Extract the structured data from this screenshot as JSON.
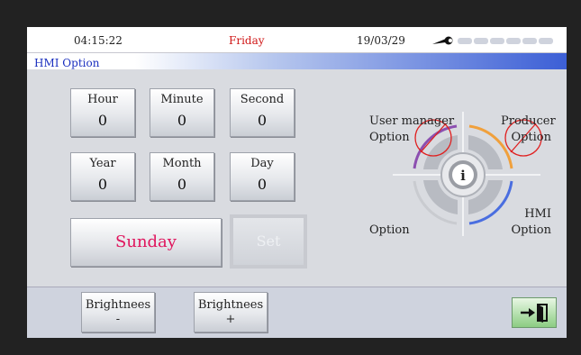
{
  "status": {
    "time": "04:15:22",
    "weekday": "Friday",
    "date": "19/03/29"
  },
  "title": {
    "tab": "HMI Option"
  },
  "time_fields": [
    {
      "label": "Hour",
      "value": "0"
    },
    {
      "label": "Minute",
      "value": "0"
    },
    {
      "label": "Second",
      "value": "0"
    }
  ],
  "date_fields": [
    {
      "label": "Year",
      "value": "0"
    },
    {
      "label": "Month",
      "value": "0"
    },
    {
      "label": "Day",
      "value": "0"
    }
  ],
  "weekday_button": "Sunday",
  "set_button": "Set",
  "options": {
    "user_manager": [
      "User manager",
      "Option"
    ],
    "producer": [
      "Producer",
      "Option"
    ],
    "bottom_left": [
      "Option"
    ],
    "hmi": [
      "HMI",
      "Option"
    ]
  },
  "footer": {
    "brightness_down": [
      "Brightnees",
      "-"
    ],
    "brightness_up": [
      "Brightnees",
      "+"
    ]
  },
  "colors": {
    "accent": "#e0155d",
    "title_blue": "#1a2fbf",
    "weekday_red": "#d01818"
  }
}
